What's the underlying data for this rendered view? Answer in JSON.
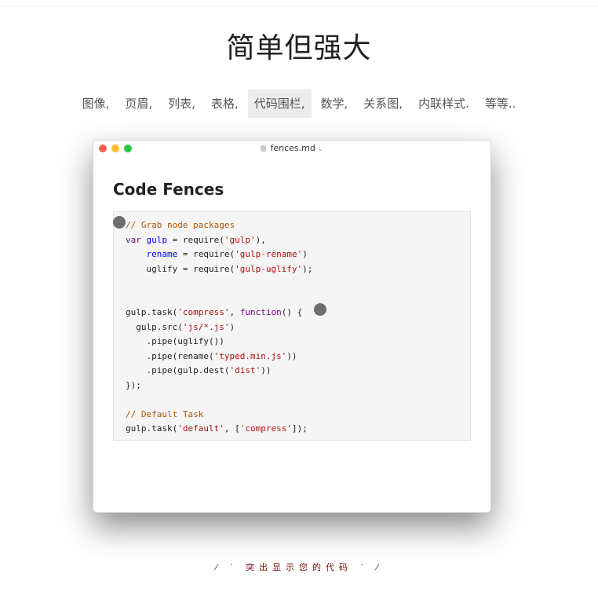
{
  "page": {
    "title": "简单但强大",
    "caption": "⁄ ˙ 突出显示您的代码 ˙ ⁄"
  },
  "features": [
    {
      "label": "图像,"
    },
    {
      "label": "页眉,"
    },
    {
      "label": "列表,"
    },
    {
      "label": "表格,"
    },
    {
      "label": "代码围栏,",
      "active": true
    },
    {
      "label": "数学,"
    },
    {
      "label": "关系图,"
    },
    {
      "label": "内联样式."
    },
    {
      "label": "等等.."
    }
  ],
  "window": {
    "filename": "fences.md",
    "doc_heading": "Code Fences"
  },
  "code_lines": [
    [
      [
        "c-comment",
        "// Grab node packages"
      ]
    ],
    [
      [
        "c-kw",
        "var"
      ],
      [
        "",
        " "
      ],
      [
        "c-def",
        "gulp"
      ],
      [
        "",
        " = require("
      ],
      [
        "c-str",
        "'gulp'"
      ],
      [
        "",
        "),"
      ]
    ],
    [
      [
        "",
        "    "
      ],
      [
        "c-def",
        "rename"
      ],
      [
        "",
        " = require("
      ],
      [
        "c-str",
        "'gulp-rename'"
      ],
      [
        "",
        ")"
      ]
    ],
    [
      [
        "",
        "    uglify = require("
      ],
      [
        "c-str",
        "'gulp-uglify'"
      ],
      [
        "",
        ");"
      ]
    ],
    [
      [
        "",
        ""
      ]
    ],
    [
      [
        "",
        ""
      ]
    ],
    [
      [
        "",
        "gulp.task("
      ],
      [
        "c-str",
        "'compress'"
      ],
      [
        "",
        ", "
      ],
      [
        "c-kw",
        "function"
      ],
      [
        "",
        "() {"
      ]
    ],
    [
      [
        "",
        "  gulp.src("
      ],
      [
        "c-str",
        "'js/*.js'"
      ],
      [
        "",
        ")"
      ]
    ],
    [
      [
        "",
        "    .pipe(uglify())"
      ]
    ],
    [
      [
        "",
        "    .pipe(rename("
      ],
      [
        "c-str",
        "'typed.min.js'"
      ],
      [
        "",
        "))"
      ]
    ],
    [
      [
        "",
        "    .pipe(gulp.dest("
      ],
      [
        "c-str",
        "'dist'"
      ],
      [
        "",
        "))"
      ]
    ],
    [
      [
        "",
        "});"
      ]
    ],
    [
      [
        "",
        ""
      ]
    ],
    [
      [
        "c-comment",
        "// Default Task"
      ]
    ],
    [
      [
        "",
        "gulp.task("
      ],
      [
        "c-str",
        "'default'"
      ],
      [
        "",
        ", ["
      ],
      [
        "c-str",
        "'compress'"
      ],
      [
        "",
        "]);"
      ]
    ]
  ],
  "colors": {
    "comment": "#aa5500",
    "keyword": "#770088",
    "definition": "#0000ff",
    "string": "#aa1111"
  }
}
